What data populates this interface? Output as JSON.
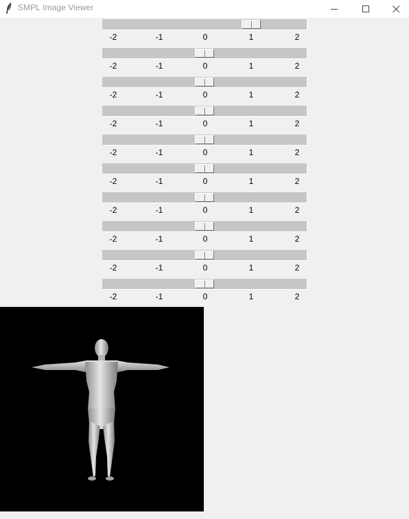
{
  "window": {
    "title": "SMPL Image Viewer",
    "icon": "feather-icon",
    "controls": [
      "minimize-icon",
      "maximize-icon",
      "close-icon"
    ]
  },
  "sliders": [
    {
      "value": 1.0,
      "from": -2,
      "to": 2,
      "ticks": [
        "-2",
        "-1",
        "0",
        "1",
        "2"
      ]
    },
    {
      "value": 0.0,
      "from": -2,
      "to": 2,
      "ticks": [
        "-2",
        "-1",
        "0",
        "1",
        "2"
      ]
    },
    {
      "value": 0.0,
      "from": -2,
      "to": 2,
      "ticks": [
        "-2",
        "-1",
        "0",
        "1",
        "2"
      ]
    },
    {
      "value": 0.0,
      "from": -2,
      "to": 2,
      "ticks": [
        "-2",
        "-1",
        "0",
        "1",
        "2"
      ]
    },
    {
      "value": 0.0,
      "from": -2,
      "to": 2,
      "ticks": [
        "-2",
        "-1",
        "0",
        "1",
        "2"
      ]
    },
    {
      "value": 0.0,
      "from": -2,
      "to": 2,
      "ticks": [
        "-2",
        "-1",
        "0",
        "1",
        "2"
      ]
    },
    {
      "value": 0.0,
      "from": -2,
      "to": 2,
      "ticks": [
        "-2",
        "-1",
        "0",
        "1",
        "2"
      ]
    },
    {
      "value": 0.0,
      "from": -2,
      "to": 2,
      "ticks": [
        "-2",
        "-1",
        "0",
        "1",
        "2"
      ]
    },
    {
      "value": 0.0,
      "from": -2,
      "to": 2,
      "ticks": [
        "-2",
        "-1",
        "0",
        "1",
        "2"
      ]
    },
    {
      "value": 0.0,
      "from": -2,
      "to": 2,
      "ticks": [
        "-2",
        "-1",
        "0",
        "1",
        "2"
      ]
    }
  ],
  "viewer": {
    "content": "t-pose-human-body-render",
    "background": "#000000"
  }
}
